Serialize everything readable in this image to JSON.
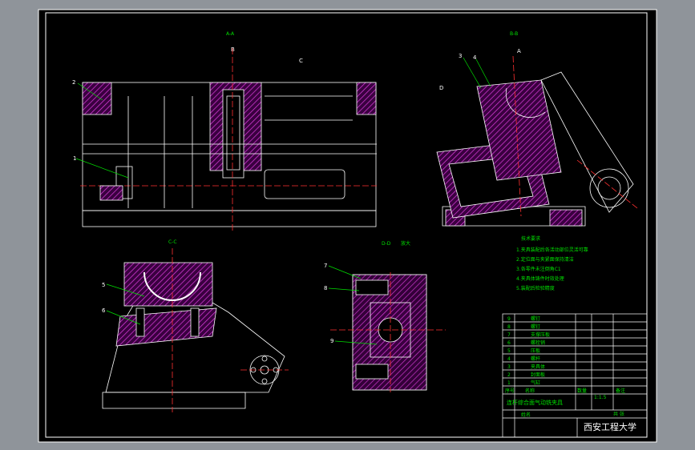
{
  "views": {
    "section_aa": "A-A",
    "section_bb": "B-B",
    "section_cc": "C-C",
    "section_dd": "D-D",
    "dd_scale": "放大",
    "mark_b": "B",
    "mark_c": "C",
    "mark_a": "A",
    "mark_d": "D"
  },
  "callouts": [
    "1",
    "2",
    "3",
    "4",
    "5",
    "6",
    "7",
    "8",
    "9"
  ],
  "notes": [
    "技术要求",
    "1.夹具装配后各活动部位灵活可靠",
    "2.定位面与夹紧面保持清洁",
    "3.各零件未注倒角C1",
    "4.夹具体铸件时效处理",
    "5.装配后检验精度"
  ],
  "bom": {
    "rows": [
      {
        "no": "9",
        "name": "螺钉"
      },
      {
        "no": "8",
        "name": "螺钉"
      },
      {
        "no": "7",
        "name": "支撑压板"
      },
      {
        "no": "6",
        "name": "螺栓销"
      },
      {
        "no": "5",
        "name": "压板"
      },
      {
        "no": "4",
        "name": "螺杆"
      },
      {
        "no": "3",
        "name": "夹具体"
      },
      {
        "no": "2",
        "name": "封面板"
      },
      {
        "no": "1",
        "name": "气缸"
      }
    ],
    "header": {
      "no": "序号",
      "name": "名称",
      "qty": "数量",
      "note": "备注"
    },
    "drawing_title": "连杆综合面气动铣夹具",
    "scale": "1:1.5",
    "designer": "姓名",
    "count_label": "共 张",
    "school": "西安工程大学"
  }
}
